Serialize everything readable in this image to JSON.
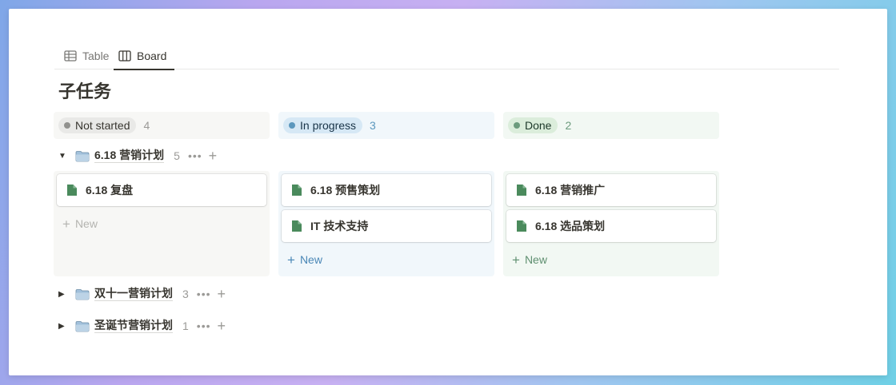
{
  "tabs": [
    {
      "label": "Table",
      "icon": "table-icon",
      "active": false
    },
    {
      "label": "Board",
      "icon": "board-icon",
      "active": true
    }
  ],
  "page_title": "子任务",
  "columns": [
    {
      "label": "Not started",
      "count": "4",
      "color": "#91918e"
    },
    {
      "label": "In progress",
      "count": "3",
      "color": "#5b97bd"
    },
    {
      "label": "Done",
      "count": "2",
      "color": "#6c9b7d"
    }
  ],
  "groups": [
    {
      "name": "6.18 营销计划",
      "count": "5",
      "expanded": true,
      "icon": "folder-icon",
      "lanes": [
        {
          "cards": [
            "6.18 复盘"
          ]
        },
        {
          "cards": [
            "6.18 预售策划",
            "IT 技术支持"
          ]
        },
        {
          "cards": [
            "6.18 营销推广",
            "6.18 选品策划"
          ]
        }
      ]
    },
    {
      "name": "双十一营销计划",
      "count": "3",
      "expanded": false,
      "icon": "folder-icon"
    },
    {
      "name": "圣诞节营销计划",
      "count": "1",
      "expanded": false,
      "icon": "folder-icon"
    }
  ],
  "new_label": "New",
  "more_label": "•••",
  "add_label": "+",
  "expanded_arrow": "▼",
  "collapsed_arrow": "▶",
  "card_icon": "page-icon",
  "accent_colors": {
    "page_icon": "#4a8a5c",
    "active_tab": "#37352f"
  }
}
